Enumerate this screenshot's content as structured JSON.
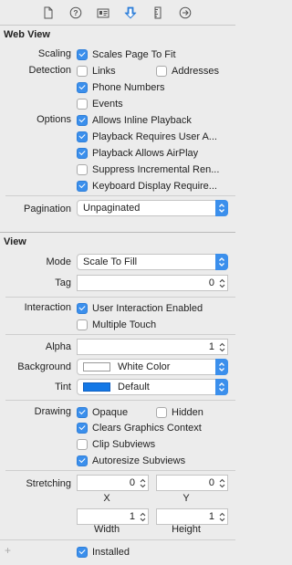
{
  "tabs": [
    {
      "icon": "file-icon"
    },
    {
      "icon": "help-icon"
    },
    {
      "icon": "identity-icon"
    },
    {
      "icon": "attributes-icon",
      "selected": true
    },
    {
      "icon": "size-ruler-icon"
    },
    {
      "icon": "connections-icon"
    }
  ],
  "web_view": {
    "title": "Web View",
    "scaling_label": "Scaling",
    "scales_page_to_fit": {
      "label": "Scales Page To Fit",
      "checked": true
    },
    "detection_label": "Detection",
    "links": {
      "label": "Links",
      "checked": false
    },
    "addresses": {
      "label": "Addresses",
      "checked": false
    },
    "phone_numbers": {
      "label": "Phone Numbers",
      "checked": true
    },
    "events": {
      "label": "Events",
      "checked": false
    },
    "options_label": "Options",
    "allows_inline_playback": {
      "label": "Allows Inline Playback",
      "checked": true
    },
    "playback_requires_user_action": {
      "label": "Playback Requires User A...",
      "checked": true
    },
    "playback_allows_airplay": {
      "label": "Playback Allows AirPlay",
      "checked": true
    },
    "suppress_incremental_rendering": {
      "label": "Suppress Incremental Ren...",
      "checked": false
    },
    "keyboard_display_requires": {
      "label": "Keyboard Display Require...",
      "checked": true
    },
    "pagination_label": "Pagination",
    "pagination_value": "Unpaginated"
  },
  "view": {
    "title": "View",
    "mode_label": "Mode",
    "mode_value": "Scale To Fill",
    "tag_label": "Tag",
    "tag_value": "0",
    "interaction_label": "Interaction",
    "user_interaction_enabled": {
      "label": "User Interaction Enabled",
      "checked": true
    },
    "multiple_touch": {
      "label": "Multiple Touch",
      "checked": false
    },
    "alpha_label": "Alpha",
    "alpha_value": "1",
    "background_label": "Background",
    "background_value": "White Color",
    "background_color": "#ffffff",
    "tint_label": "Tint",
    "tint_value": "Default",
    "tint_color": "#1478e6",
    "drawing_label": "Drawing",
    "opaque": {
      "label": "Opaque",
      "checked": true
    },
    "hidden": {
      "label": "Hidden",
      "checked": false
    },
    "clears_graphics_context": {
      "label": "Clears Graphics Context",
      "checked": true
    },
    "clip_subviews": {
      "label": "Clip Subviews",
      "checked": false
    },
    "autoresize_subviews": {
      "label": "Autoresize Subviews",
      "checked": true
    },
    "stretching_label": "Stretching",
    "stretch_x": {
      "value": "0",
      "label": "X"
    },
    "stretch_y": {
      "value": "0",
      "label": "Y"
    },
    "stretch_width": {
      "value": "1",
      "label": "Width"
    },
    "stretch_height": {
      "value": "1",
      "label": "Height"
    },
    "installed": {
      "label": "Installed",
      "checked": true
    }
  },
  "accent_color": "#3b8fec"
}
